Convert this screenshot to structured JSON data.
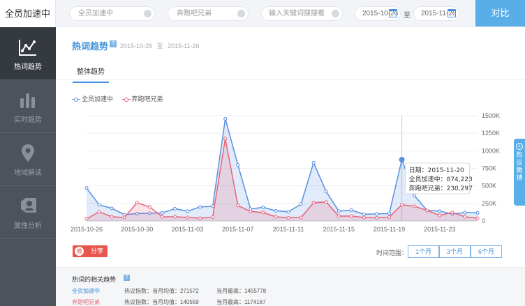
{
  "app": {
    "title": "全员加速中"
  },
  "search": {
    "keyword1": "全员加速中",
    "keyword2": "奔跑吧兄弟",
    "placeholder": "输入关键词搜搜看",
    "date_from": "2015-10-26",
    "date_sep": "至",
    "date_to": "2015-11-26",
    "compare_label": "对比"
  },
  "sidebar": {
    "items": [
      {
        "label": "热词趋势",
        "icon": "trend-chart-icon",
        "active": true
      },
      {
        "label": "实时趋势",
        "icon": "bars-icon",
        "active": false
      },
      {
        "label": "地域解读",
        "icon": "map-pin-icon",
        "active": false
      },
      {
        "label": "属性分析",
        "icon": "person-tag-icon",
        "active": false
      }
    ]
  },
  "main": {
    "title": "热词趋势",
    "help": "?",
    "range_from": "2015-10-26",
    "range_sep": "至",
    "range_to": "2015-11-26",
    "tab": "整体趋势"
  },
  "colors": {
    "series1": "#5a90e0",
    "series2": "#e8637a",
    "accent": "#5aaee8"
  },
  "chart_data": {
    "type": "area",
    "x": [
      "2015-10-26",
      "2015-10-27",
      "2015-10-28",
      "2015-10-29",
      "2015-10-30",
      "2015-10-31",
      "2015-11-01",
      "2015-11-02",
      "2015-11-03",
      "2015-11-04",
      "2015-11-05",
      "2015-11-06",
      "2015-11-07",
      "2015-11-08",
      "2015-11-09",
      "2015-11-10",
      "2015-11-11",
      "2015-11-12",
      "2015-11-13",
      "2015-11-14",
      "2015-11-15",
      "2015-11-16",
      "2015-11-17",
      "2015-11-18",
      "2015-11-19",
      "2015-11-20",
      "2015-11-21",
      "2015-11-22",
      "2015-11-23",
      "2015-11-24",
      "2015-11-25",
      "2015-11-26"
    ],
    "xticks": [
      "2015-10-26",
      "2015-10-30",
      "2015-11-03",
      "2015-11-07",
      "2015-11-11",
      "2015-11-15",
      "2015-11-19",
      "2015-11-23"
    ],
    "yticks": [
      "0",
      "250K",
      "500K",
      "750K",
      "1000K",
      "1250K",
      "1500K"
    ],
    "ylim": [
      0,
      1500000
    ],
    "series": [
      {
        "name": "全员加速中",
        "values": [
          470000,
          230000,
          180000,
          90000,
          105000,
          110000,
          115000,
          175000,
          140000,
          200000,
          210000,
          1455778,
          800000,
          170000,
          195000,
          145000,
          130000,
          240000,
          830000,
          420000,
          140000,
          155000,
          95000,
          100000,
          105000,
          874223,
          360000,
          150000,
          140000,
          100000,
          120000,
          115000
        ]
      },
      {
        "name": "奔跑吧兄弟",
        "values": [
          30000,
          130000,
          60000,
          50000,
          260000,
          200000,
          60000,
          60000,
          50000,
          40000,
          55000,
          1174167,
          220000,
          135000,
          120000,
          60000,
          45000,
          50000,
          260000,
          270000,
          70000,
          70000,
          50000,
          45000,
          55000,
          230297,
          210000,
          150000,
          80000,
          120000,
          60000,
          40000
        ]
      }
    ],
    "tooltip": {
      "date_line": "日期：2015-11-20",
      "line1": "全员加速中：874,223",
      "line2": "奔跑吧兄弟：230,297",
      "index": 25
    }
  },
  "share": {
    "label": "分享",
    "icon": "weibo-icon"
  },
  "time_range": {
    "label": "时间范围：",
    "buttons": [
      "1个月",
      "3个月",
      "6个月"
    ]
  },
  "related": {
    "title": "热词的相关趋势",
    "help": "?",
    "rows": [
      {
        "keyword": "全员加速中",
        "avg": "热议指数：当月均值：271572",
        "max": "当月最高：1455778"
      },
      {
        "keyword": "奔跑吧兄弟",
        "avg": "热议指数：当月均值：140559",
        "max": "当月最高：1174167"
      }
    ]
  },
  "float_tab": {
    "label": "热议微博"
  }
}
